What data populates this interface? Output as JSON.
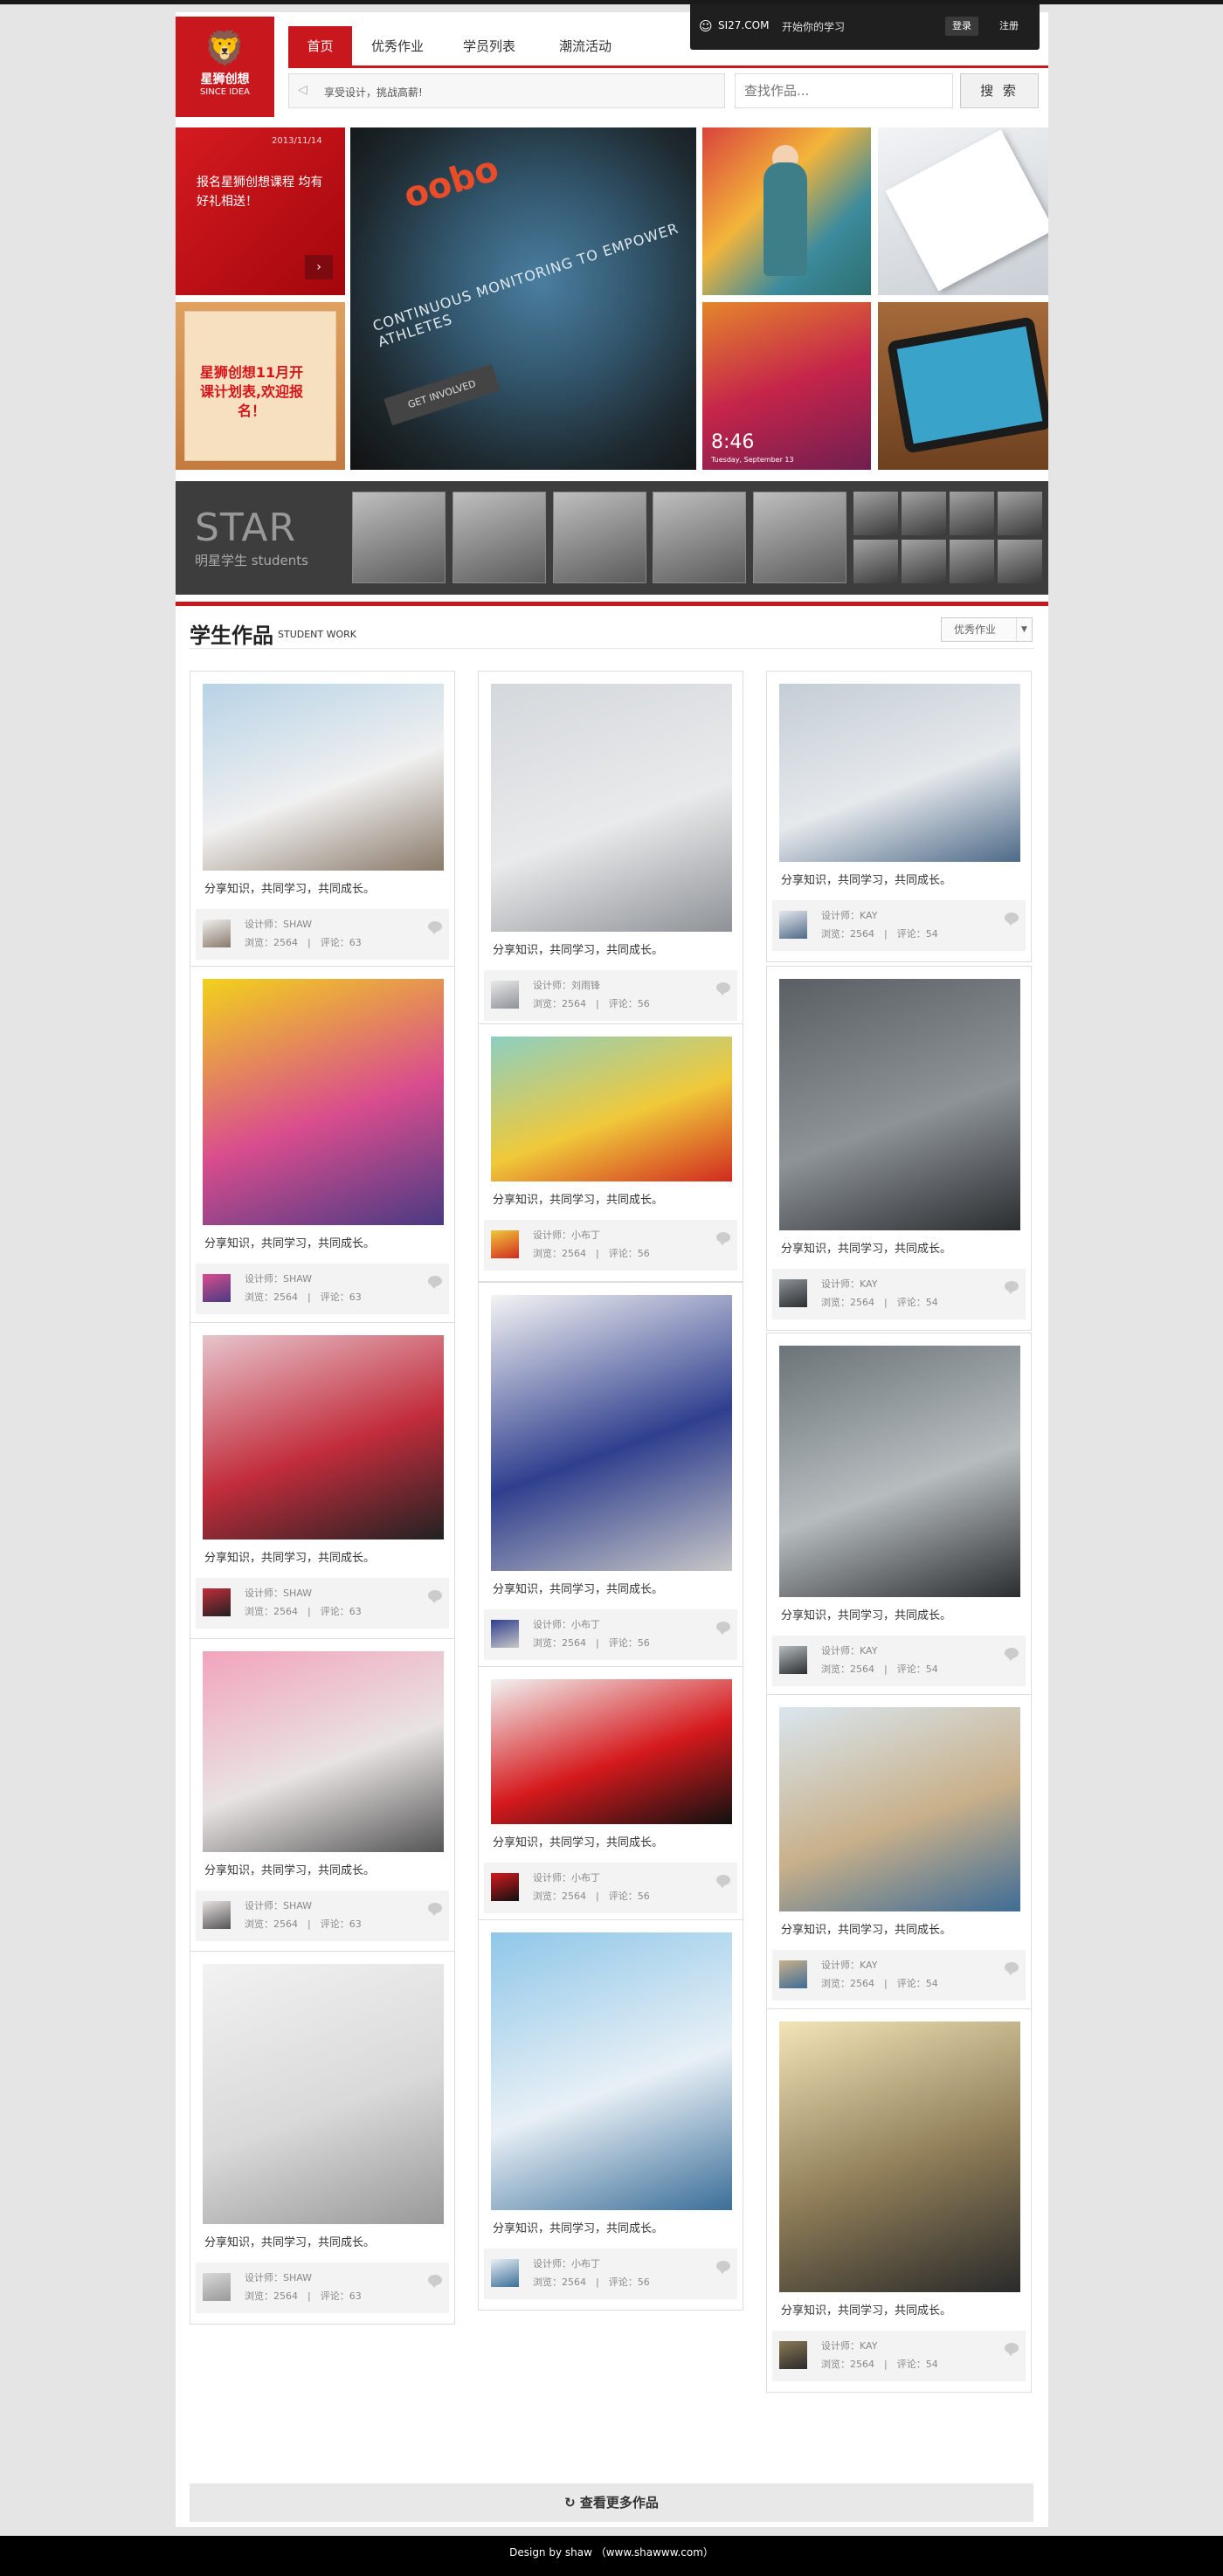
{
  "userbar": {
    "site": "SI27.COM",
    "slogan": "开始你的学习",
    "login": "登录",
    "register": "注册"
  },
  "logo": {
    "name": "星狮创想",
    "since": "SINCE IDEA"
  },
  "nav": {
    "tabs": [
      {
        "label": "首页"
      },
      {
        "label": "优秀作业"
      },
      {
        "label": "学员列表"
      },
      {
        "label": "潮流活动"
      }
    ]
  },
  "announce": {
    "text": "享受设计，挑战高薪!"
  },
  "search": {
    "placeholder": "查找作品...",
    "button": "搜 索"
  },
  "hero": {
    "date": "2013/11/14",
    "promo1": "报名星狮创想课程 均有好礼相送！",
    "promo2": "星狮创想11月开课计划表,欢迎报名！",
    "blur_logo": "oobo",
    "blur_tagline": "CONTINUOUS MONITORING TO EMPOWER ATHLETES",
    "blur_button": "GET INVOLVED",
    "phone_time": "8:46",
    "phone_date": "Tuesday, September 13"
  },
  "star": {
    "title": "STAR",
    "subtitle": "明星学生 students"
  },
  "section": {
    "title": "学生作品",
    "subtitle": "STUDENT WORK",
    "filter": "优秀作业"
  },
  "cards": [
    {
      "desc": "分享知识，共同学习，共同成长。",
      "designer": "设计师：SHAW",
      "stats": "浏览：2564　|　评论：63",
      "colors": [
        "#b7d3e6",
        "#f0f0f0",
        "#8a7a6a"
      ]
    },
    {
      "desc": "分享知识，共同学习，共同成长。",
      "designer": "设计师：SHAW",
      "stats": "浏览：2564　|　评论：63",
      "colors": [
        "#f2d21b",
        "#d94d8e",
        "#4a3a82"
      ]
    },
    {
      "desc": "分享知识，共同学习，共同成长。",
      "designer": "设计师：SHAW",
      "stats": "浏览：2564　|　评论：63",
      "colors": [
        "#e7c4cc",
        "#c22c3b",
        "#222222"
      ]
    },
    {
      "desc": "分享知识，共同学习，共同成长。",
      "designer": "设计师：SHAW",
      "stats": "浏览：2564　|　评论：63",
      "colors": [
        "#f2a4bb",
        "#e8e3e3",
        "#555555"
      ]
    },
    {
      "desc": "分享知识，共同学习，共同成长。",
      "designer": "设计师：SHAW",
      "stats": "浏览：2564　|　评论：63",
      "colors": [
        "#f2f2f2",
        "#d9d9d9",
        "#999999"
      ]
    },
    {
      "desc": "分享知识，共同学习，共同成长。",
      "designer": "设计师：刘雨锋",
      "stats": "浏览：2564　|　评论：56",
      "colors": [
        "#d4d8dc",
        "#e9eaeb",
        "#8e9297"
      ]
    },
    {
      "desc": "分享知识，共同学习，共同成长。",
      "designer": "设计师：小布丁",
      "stats": "浏览：2564　|　评论：56",
      "colors": [
        "#8ccfc2",
        "#f0c93a",
        "#d12a1f"
      ]
    },
    {
      "desc": "分享知识，共同学习，共同成长。",
      "designer": "设计师：小布丁",
      "stats": "浏览：2564　|　评论：56",
      "colors": [
        "#f4f4f4",
        "#2f3f8e",
        "#c7c7c7"
      ]
    },
    {
      "desc": "分享知识，共同学习，共同成长。",
      "designer": "设计师：小布丁",
      "stats": "浏览：2564　|　评论：56",
      "colors": [
        "#f2f2f2",
        "#d5191c",
        "#111111"
      ]
    },
    {
      "desc": "分享知识，共同学习，共同成长。",
      "designer": "设计师：小布丁",
      "stats": "浏览：2564　|　评论：56",
      "colors": [
        "#8fc7e8",
        "#e8f0f6",
        "#3b6e98"
      ]
    },
    {
      "desc": "分享知识，共同学习，共同成长。",
      "designer": "设计师：KAY",
      "stats": "浏览：2564　|　评论：54",
      "colors": [
        "#c4cdd6",
        "#e6e9ec",
        "#4e6a88"
      ]
    },
    {
      "desc": "分享知识，共同学习，共同成长。",
      "designer": "设计师：KAY",
      "stats": "浏览：2564　|　评论：54",
      "colors": [
        "#5a5f63",
        "#8e9398",
        "#2a2e31"
      ]
    },
    {
      "desc": "分享知识，共同学习，共同成长。",
      "designer": "设计师：KAY",
      "stats": "浏览：2564　|　评论：54",
      "colors": [
        "#6b7478",
        "#b7bcbf",
        "#2a2e31"
      ]
    },
    {
      "desc": "分享知识，共同学习，共同成长。",
      "designer": "设计师：KAY",
      "stats": "浏览：2564　|　评论：54",
      "colors": [
        "#d9e6ee",
        "#c8b08a",
        "#3f6c96"
      ]
    },
    {
      "desc": "分享知识，共同学习，共同成长。",
      "designer": "设计师：KAY",
      "stats": "浏览：2564　|　评论：54",
      "colors": [
        "#f3e4b8",
        "#8b7a55",
        "#2a2a2a"
      ]
    }
  ],
  "more": {
    "label": "查看更多作品"
  },
  "footer": {
    "text": "Design by shaw （www.shawww.com）"
  },
  "colors": {
    "brand": "#c8171d",
    "dark": "#1f1f1f"
  }
}
